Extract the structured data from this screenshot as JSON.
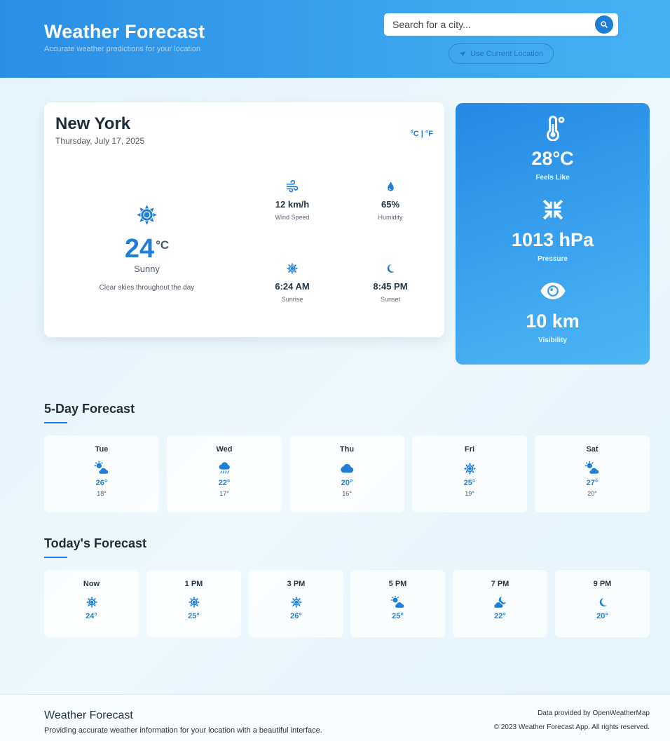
{
  "header": {
    "title": "Weather Forecast",
    "subtitle": "Accurate weather predictions for your location",
    "search_placeholder": "Search for a city...",
    "location_button": "Use Current Location"
  },
  "current": {
    "city": "New York",
    "date": "Thursday, July 17, 2025",
    "unit_toggle": "°C | °F",
    "temperature": "24",
    "unit": "°C",
    "condition": "Sunny",
    "description": "Clear skies throughout the day",
    "icon": "sun-icon",
    "stats": [
      {
        "icon": "wind-icon",
        "value": "12 km/h",
        "label": "Wind Speed"
      },
      {
        "icon": "droplet-icon",
        "value": "65%",
        "label": "Humidity"
      },
      {
        "icon": "sunrise-icon",
        "value": "6:24 AM",
        "label": "Sunrise"
      },
      {
        "icon": "moon-icon",
        "value": "8:45 PM",
        "label": "Sunset"
      }
    ]
  },
  "details": [
    {
      "icon": "thermometer-icon",
      "value": "28°C",
      "label": "Feels Like"
    },
    {
      "icon": "compress-icon",
      "value": "1013 hPa",
      "label": "Pressure"
    },
    {
      "icon": "eye-icon",
      "value": "10 km",
      "label": "Visibility"
    }
  ],
  "five_day": {
    "title": "5-Day Forecast",
    "days": [
      {
        "day": "Tue",
        "icon": "partly-cloudy-icon",
        "high": "26°",
        "low": "18°"
      },
      {
        "day": "Wed",
        "icon": "rain-icon",
        "high": "22°",
        "low": "17°"
      },
      {
        "day": "Thu",
        "icon": "cloud-icon",
        "high": "20°",
        "low": "16°"
      },
      {
        "day": "Fri",
        "icon": "sun-icon",
        "high": "25°",
        "low": "19°"
      },
      {
        "day": "Sat",
        "icon": "partly-cloudy-icon",
        "high": "27°",
        "low": "20°"
      }
    ]
  },
  "today": {
    "title": "Today's Forecast",
    "hours": [
      {
        "time": "Now",
        "icon": "sun-icon",
        "temp": "24°"
      },
      {
        "time": "1 PM",
        "icon": "sun-icon",
        "temp": "25°"
      },
      {
        "time": "3 PM",
        "icon": "sun-icon",
        "temp": "26°"
      },
      {
        "time": "5 PM",
        "icon": "partly-cloudy-icon",
        "temp": "25°"
      },
      {
        "time": "7 PM",
        "icon": "night-cloud-icon",
        "temp": "22°"
      },
      {
        "time": "9 PM",
        "icon": "moon-icon",
        "temp": "20°"
      }
    ]
  },
  "footer": {
    "title": "Weather Forecast",
    "subtitle": "Providing accurate weather information for your location with a beautiful interface.",
    "credit": "Data provided by OpenWeatherMap",
    "copyright": "© 2023 Weather Forecast App. All rights reserved."
  },
  "colors": {
    "accent": "#1f7fd8",
    "header_start": "#2b8fe6",
    "header_end": "#45b1f2"
  }
}
